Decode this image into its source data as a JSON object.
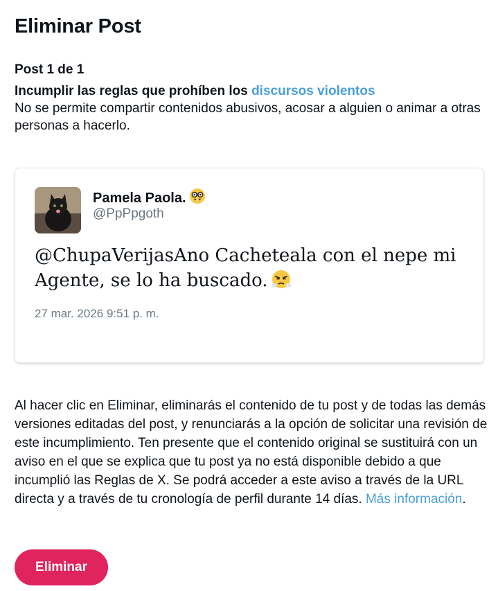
{
  "header": {
    "title": "Eliminar Post"
  },
  "violation": {
    "post_count": "Post 1 de 1",
    "rule_prefix": "Incumplir las reglas que prohíben los",
    "rule_link": "discursos violentos",
    "description": "No se permite compartir contenidos abusivos, acosar a alguien o animar a otras personas a hacerlo."
  },
  "post": {
    "author_name": "Pamela Paola.",
    "author_emoji": "nerd-face-icon",
    "handle": "@PpPpgoth",
    "text": "@ChupaVerijasAno Cacheteala con el nepe mi Agente, se lo ha buscado.",
    "text_emoji": "face-with-steam-icon",
    "timestamp": "27 mar. 2026 9:51 p. m."
  },
  "info": {
    "text": "Al hacer clic en Eliminar, eliminarás el contenido de tu post y de todas las demás versiones editadas del post, y renunciarás a la opción de solicitar una revisión de este incumplimiento. Ten presente que el contenido original se sustituirá con un aviso en el que se explica que tu post ya no está disponible debido a que incumplió las Reglas de X. Se podrá acceder a este aviso a través de la URL directa y a través de tu cronología de perfil durante 14 días.",
    "link": "Más información",
    "suffix": "."
  },
  "actions": {
    "delete_label": "Eliminar"
  },
  "colors": {
    "accent_link": "#4a9fd9",
    "delete_button": "#e0245e",
    "muted_text": "#6b7780"
  }
}
